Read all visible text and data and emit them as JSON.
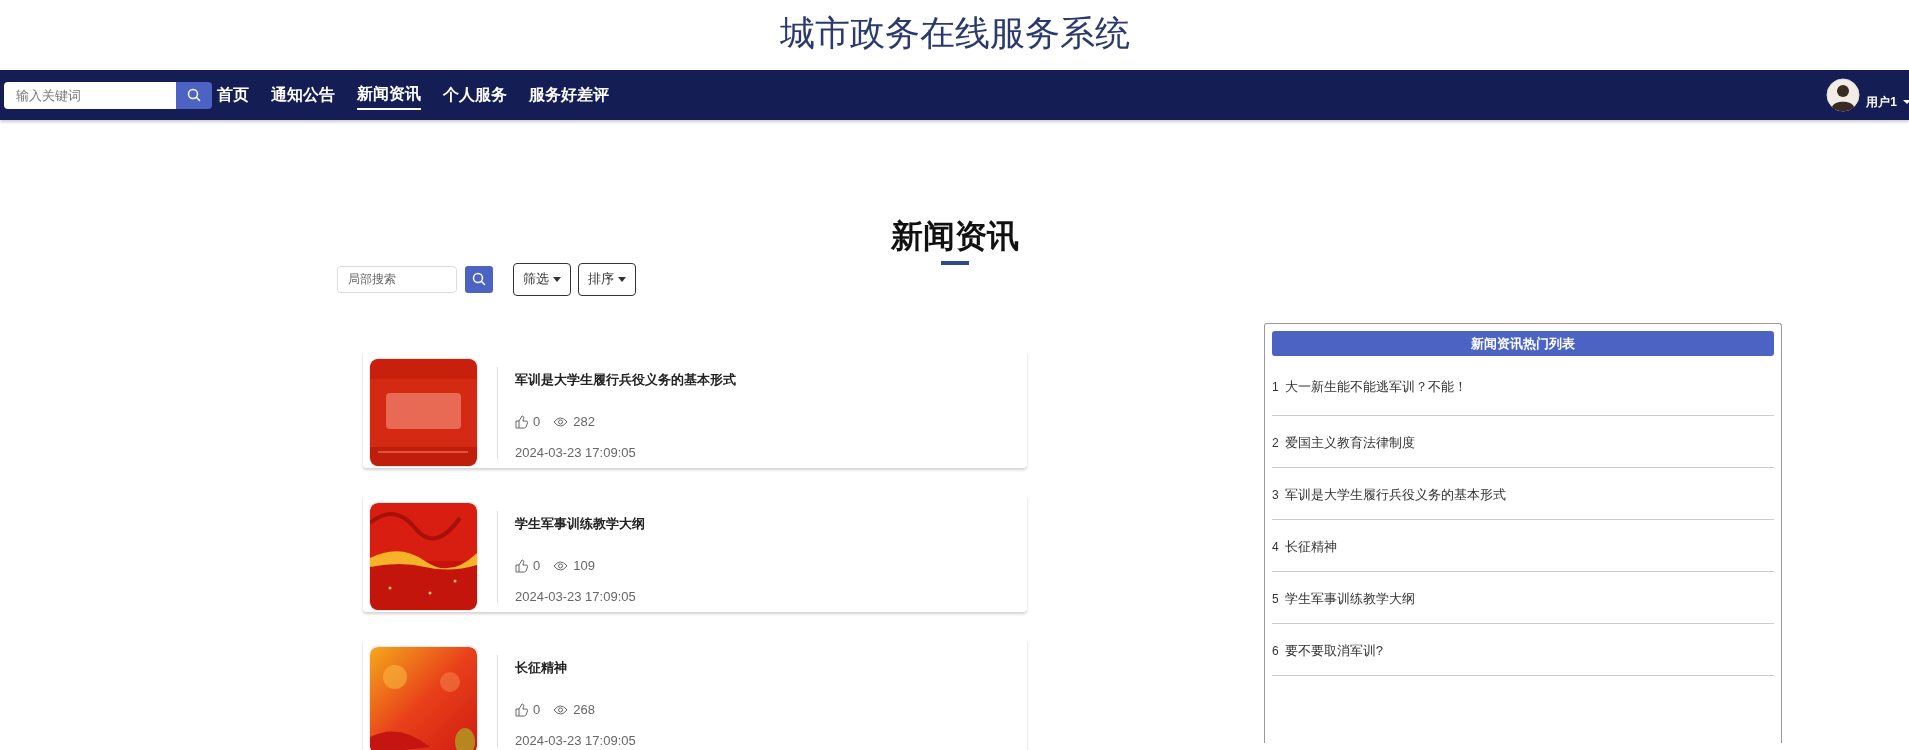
{
  "header": {
    "title": "城市政务在线服务系统"
  },
  "navbar": {
    "search": {
      "placeholder": "输入关键词"
    },
    "items": [
      {
        "label": "首页",
        "selected": false
      },
      {
        "label": "通知公告",
        "selected": false
      },
      {
        "label": "新闻资讯",
        "selected": true
      },
      {
        "label": "个人服务",
        "selected": false
      },
      {
        "label": "服务好差评",
        "selected": false
      }
    ],
    "user": {
      "name": "用户1"
    }
  },
  "page": {
    "heading": "新闻资讯",
    "search": {
      "placeholder": "局部搜索"
    },
    "dropdowns": [
      {
        "label": "筛选"
      },
      {
        "label": "排序"
      }
    ]
  },
  "news": [
    {
      "title": "军训是大学生履行兵役义务的基本形式",
      "likes": "0",
      "views": "282",
      "date": "2024-03-23 17:09:05"
    },
    {
      "title": "学生军事训练教学大纲",
      "likes": "0",
      "views": "109",
      "date": "2024-03-23 17:09:05"
    },
    {
      "title": "长征精神",
      "likes": "0",
      "views": "268",
      "date": "2024-03-23 17:09:05"
    }
  ],
  "hot_list": {
    "title": "新闻资讯热门列表",
    "items": [
      {
        "rank": "1",
        "title": "大一新生能不能逃军训？不能！"
      },
      {
        "rank": "2",
        "title": "爱国主义教育法律制度"
      },
      {
        "rank": "3",
        "title": "军训是大学生履行兵役义务的基本形式"
      },
      {
        "rank": "4",
        "title": "长征精神"
      },
      {
        "rank": "5",
        "title": "学生军事训练教学大纲"
      },
      {
        "rank": "6",
        "title": "要不要取消军训?"
      }
    ]
  }
}
